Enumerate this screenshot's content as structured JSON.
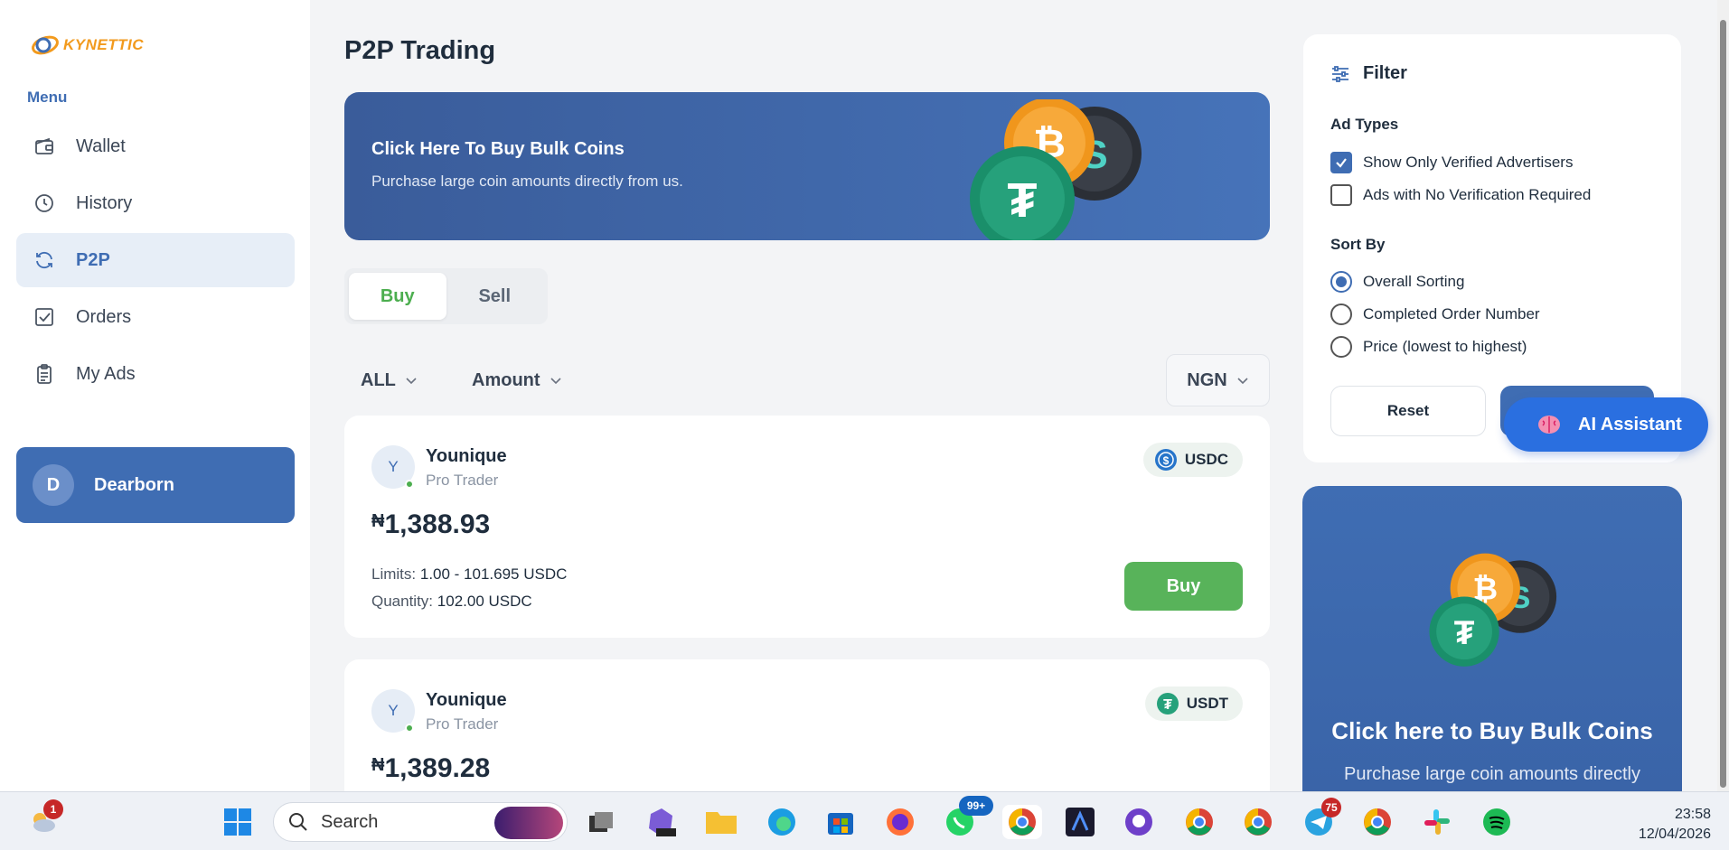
{
  "app": {
    "logo_text": "KYNETTIC"
  },
  "sidebar": {
    "menu_label": "Menu",
    "items": [
      {
        "label": "Wallet",
        "icon": "wallet-icon"
      },
      {
        "label": "History",
        "icon": "clock-icon"
      },
      {
        "label": "P2P",
        "icon": "refresh-icon",
        "active": true
      },
      {
        "label": "Orders",
        "icon": "checkbox-icon"
      },
      {
        "label": "My Ads",
        "icon": "clipboard-icon"
      }
    ],
    "user": {
      "initial": "D",
      "name": "Dearborn"
    }
  },
  "main": {
    "title": "P2P Trading",
    "banner": {
      "title": "Click Here To Buy Bulk Coins",
      "subtitle": "Purchase large coin amounts directly from us."
    },
    "tabs": [
      {
        "label": "Buy",
        "active": true
      },
      {
        "label": "Sell"
      }
    ],
    "filters": {
      "asset": "ALL",
      "amount": "Amount",
      "currency": "NGN"
    },
    "offers": [
      {
        "initial": "Y",
        "trader": "Younique",
        "role": "Pro Trader",
        "currency_symbol": "₦",
        "price": "1,388.93",
        "coin": "USDC",
        "limits_label": "Limits:",
        "limits": "1.00 - 101.695 USDC",
        "quantity_label": "Quantity:",
        "quantity": "102.00 USDC",
        "action": "Buy"
      },
      {
        "initial": "Y",
        "trader": "Younique",
        "role": "Pro Trader",
        "currency_symbol": "₦",
        "price": "1,389.28",
        "coin": "USDT"
      }
    ]
  },
  "filter_panel": {
    "title": "Filter",
    "ad_types_label": "Ad Types",
    "ad_types": [
      {
        "label": "Show Only Verified Advertisers",
        "checked": true
      },
      {
        "label": "Ads with No Verification Required",
        "checked": false
      }
    ],
    "sort_label": "Sort By",
    "sort_options": [
      {
        "label": "Overall Sorting",
        "selected": true
      },
      {
        "label": "Completed Order Number",
        "selected": false
      },
      {
        "label": "Price (lowest to highest)",
        "selected": false
      }
    ],
    "reset_label": "Reset"
  },
  "ai_assistant": {
    "label": "AI Assistant"
  },
  "promo": {
    "title": "Click here to Buy Bulk Coins",
    "subtitle": "Purchase large coin amounts directly"
  },
  "taskbar": {
    "search_placeholder": "Search",
    "weather_badge": "1",
    "whatsapp_badge": "99+",
    "telegram_badge": "75",
    "time": "23:58",
    "date": "12/04/2026"
  },
  "colors": {
    "primary": "#3f6db3",
    "buy_green": "#58b35a",
    "usdc_blue": "#2775ca",
    "usdt_green": "#26a17b"
  }
}
